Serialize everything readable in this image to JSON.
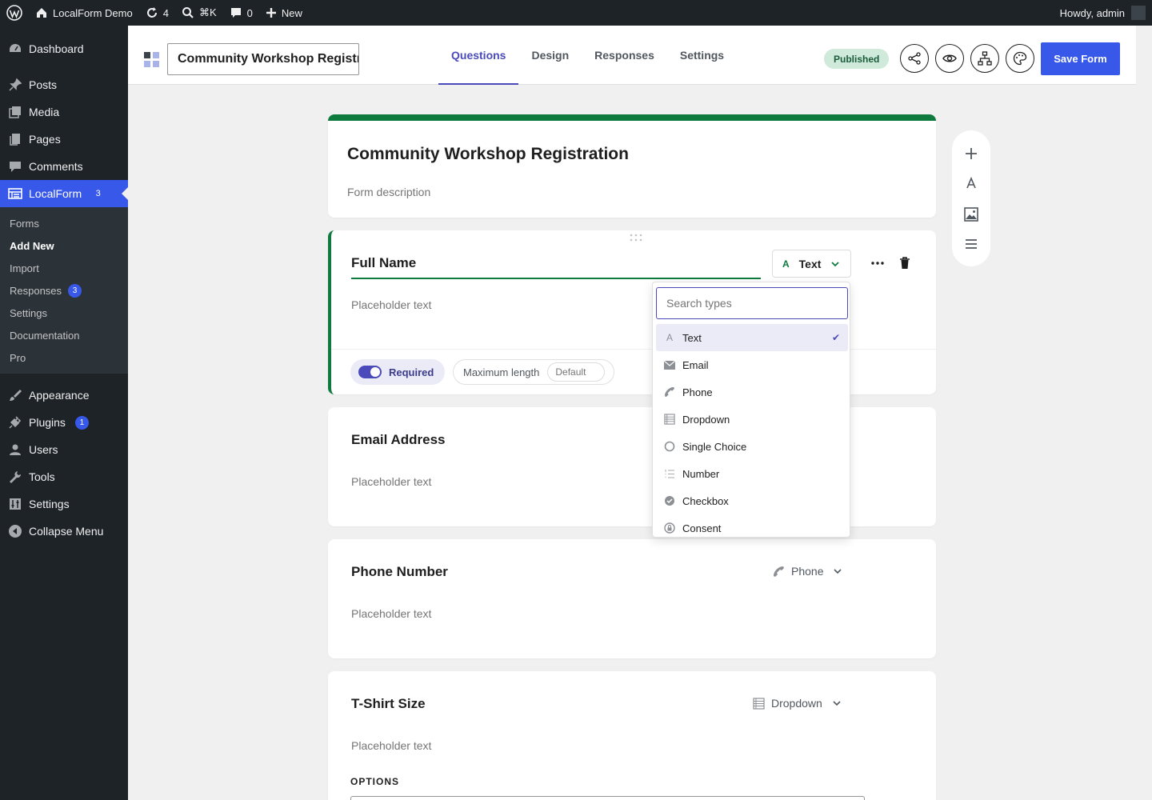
{
  "adminbar": {
    "site_name": "LocalForm Demo",
    "updates_count": "4",
    "search_shortcut": "⌘K",
    "comments_count": "0",
    "new_label": "New",
    "howdy": "Howdy, admin"
  },
  "sidebar": {
    "items_top": [
      {
        "label": "Dashboard",
        "icon": "dashboard-icon"
      },
      {
        "label": "Posts",
        "icon": "pin-icon"
      },
      {
        "label": "Media",
        "icon": "media-icon"
      },
      {
        "label": "Pages",
        "icon": "pages-icon"
      },
      {
        "label": "Comments",
        "icon": "comment-icon"
      }
    ],
    "current": {
      "label": "LocalForm",
      "badge": "3"
    },
    "submenu": [
      {
        "label": "Forms"
      },
      {
        "label": "Add New"
      },
      {
        "label": "Import"
      },
      {
        "label": "Responses",
        "badge": "3"
      },
      {
        "label": "Settings"
      },
      {
        "label": "Documentation"
      },
      {
        "label": "Pro"
      }
    ],
    "items_bottom": [
      {
        "label": "Appearance"
      },
      {
        "label": "Plugins",
        "badge": "1"
      },
      {
        "label": "Users"
      },
      {
        "label": "Tools"
      },
      {
        "label": "Settings"
      },
      {
        "label": "Collapse Menu"
      }
    ]
  },
  "header": {
    "form_title_value": "Community Workshop Registr",
    "tabs": [
      "Questions",
      "Design",
      "Responses",
      "Settings"
    ],
    "status": "Published",
    "save_label": "Save Form"
  },
  "form": {
    "title": "Community Workshop Registration",
    "description_placeholder": "Form description"
  },
  "questions": [
    {
      "label": "Full Name",
      "placeholder": "Placeholder text",
      "type": "Text"
    },
    {
      "label": "Email Address",
      "placeholder": "Placeholder text"
    },
    {
      "label": "Phone Number",
      "placeholder": "Placeholder text",
      "type": "Phone"
    },
    {
      "label": "T-Shirt Size",
      "placeholder": "Placeholder text",
      "type": "Dropdown",
      "options_label": "OPTIONS"
    }
  ],
  "active_question": {
    "required_label": "Required",
    "required": true,
    "max_length_label": "Maximum length",
    "max_length_placeholder": "Default"
  },
  "type_dropdown": {
    "search_placeholder": "Search types",
    "items": [
      {
        "label": "Text",
        "icon": "text-icon",
        "selected": true
      },
      {
        "label": "Email",
        "icon": "envelope-icon"
      },
      {
        "label": "Phone",
        "icon": "phone-icon"
      },
      {
        "label": "Dropdown",
        "icon": "list-icon"
      },
      {
        "label": "Single Choice",
        "icon": "radio-icon"
      },
      {
        "label": "Number",
        "icon": "number-list-icon"
      },
      {
        "label": "Checkbox",
        "icon": "check-circle-icon"
      },
      {
        "label": "Consent",
        "icon": "lock-icon"
      }
    ]
  },
  "colors": {
    "accent": "#3858e9",
    "active_tab": "#4a4aba",
    "form_accent": "#0e7a3e",
    "admin_bg": "#1d2327"
  }
}
